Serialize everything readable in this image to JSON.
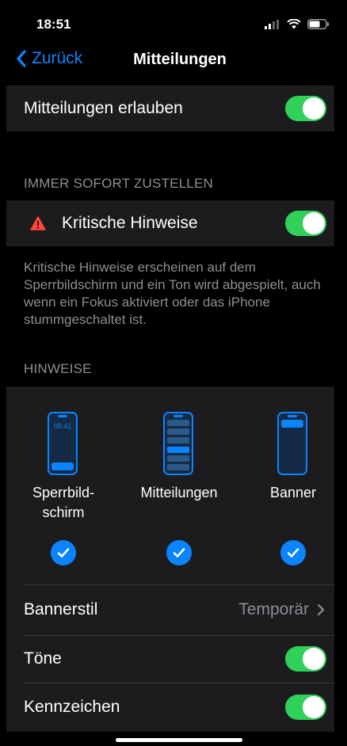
{
  "status_bar": {
    "time": "18:51"
  },
  "nav": {
    "back_label": "Zurück",
    "title": "Mitteilungen"
  },
  "allow": {
    "label": "Mitteilungen erlauben",
    "enabled": true
  },
  "immediate_section": {
    "header": "IMMER SOFORT ZUSTELLEN",
    "critical_label": "Kritische Hinweise",
    "critical_enabled": true,
    "footer": "Kritische Hinweise erscheinen auf dem Sperrbildschirm und ein Ton wird abgespielt, auch wenn ein Fokus aktiviert oder das iPhone stummgeschaltet ist."
  },
  "alerts_section": {
    "header": "HINWEISE",
    "styles": [
      {
        "label_line1": "Sperrbild-",
        "label_line2": "schirm",
        "checked": true,
        "phone_time": "09:41"
      },
      {
        "label_line1": "Mitteilungen",
        "label_line2": "",
        "checked": true
      },
      {
        "label_line1": "Banner",
        "label_line2": "",
        "checked": true
      }
    ],
    "banner_style_label": "Bannerstil",
    "banner_style_value": "Temporär",
    "sounds_label": "Töne",
    "sounds_enabled": true,
    "badges_label": "Kennzeichen",
    "badges_enabled": true
  },
  "colors": {
    "accent": "#0a84ff",
    "toggle_on": "#30d158",
    "warning": "#ff453a",
    "group_bg": "#1c1c1e",
    "secondary_text": "#8e8e93"
  }
}
